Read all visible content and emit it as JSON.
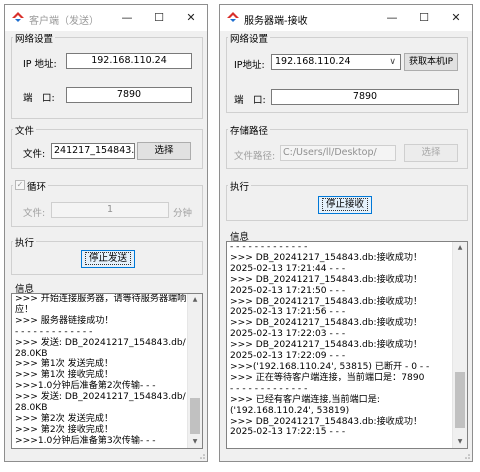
{
  "client": {
    "title": "客户端（发送）",
    "network_group": "网络设置",
    "ip_label": "IP 地址:",
    "ip_value": "192.168.110.24",
    "port_label": "端　口:",
    "port_value": "7890",
    "file_group": "文件",
    "file_label": "文件:",
    "file_value": "241217_154843.db",
    "select_button": "选择",
    "loop_group": "循环",
    "loop_checkbox_mark": "✓",
    "loop_file_label": "文件:",
    "loop_count_value": "1",
    "loop_unit": "分钟",
    "exec_group": "执行",
    "stop_send_button": "停止发送",
    "info_group": "信息",
    "log_lines": [
      ">>> 开始连接服务器，请等待服务器端响",
      "应！",
      ">>> 服务器链接成功！",
      "- - - - - - - - - - - - -",
      ">>> 发送: DB_20241217_154843.db/",
      "28.0KB",
      ">>> 第1次 发送完成！",
      ">>> 第1次 接收完成！",
      ">>>1.0分钟后准备第2次传输- - -",
      ">>> 发送: DB_20241217_154843.db/",
      "28.0KB",
      ">>> 第2次 发送完成！",
      ">>> 第2次 接收完成！",
      ">>>1.0分钟后准备第3次传输- - -"
    ]
  },
  "server": {
    "title": "服务器端-接收",
    "network_group": "网络设置",
    "ip_label": "IP地址:",
    "ip_value": "192.168.110.24",
    "get_ip_button": "获取本机IP",
    "port_label": "端　口:",
    "port_value": "7890",
    "storage_group": "存储路径",
    "path_label": "文件路径:",
    "path_value": "C:/Users/ll/Desktop/",
    "select_button": "选择",
    "exec_group": "执行",
    "stop_recv_button": "停止接收",
    "info_group": "信息",
    "log_lines": [
      "- - - - - - - - - - - - -",
      ">>> DB_20241217_154843.db:接收成功！",
      "2025-02-13 17:21:44 - - -",
      ">>> DB_20241217_154843.db:接收成功！",
      "2025-02-13 17:21:50 - - -",
      ">>> DB_20241217_154843.db:接收成功！",
      "2025-02-13 17:21:56 - - -",
      ">>> DB_20241217_154843.db:接收成功！",
      "2025-02-13 17:22:03 - - -",
      ">>> DB_20241217_154843.db:接收成功！",
      "2025-02-13 17:22:09 - - -",
      ">>>('192.168.110.24', 53815) 已断开 - 0 - -",
      ">>> 正在等待客户端连接，当前端口是：7890",
      "- - - - - - - - - - - - -",
      ">>> 已经有客户端连接,当前端口是:",
      "('192.168.110.24', 53819)",
      ">>> DB_20241217_154843.db:接收成功！",
      "2025-02-13 17:22:15 - - -"
    ]
  },
  "colors": {
    "accent": "#0078d7",
    "logo_red": "#d9302b",
    "logo_blue": "#1e6fd0"
  }
}
